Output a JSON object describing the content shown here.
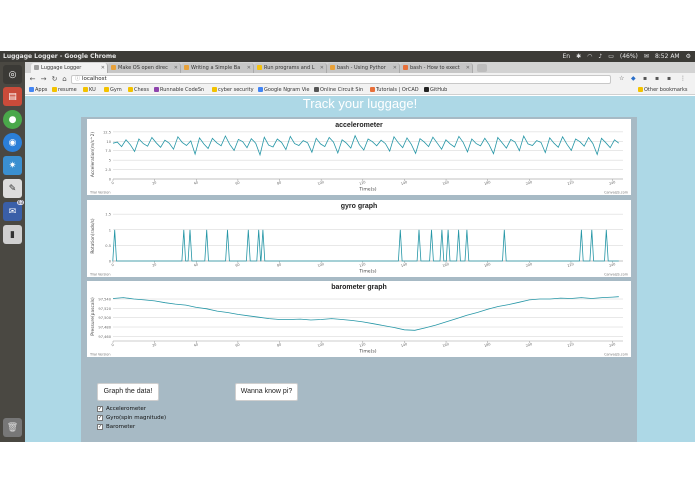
{
  "os": {
    "window_title": "Luggage Logger - Google Chrome",
    "battery": "(46%)",
    "time": "8:52 AM",
    "user": "Jon"
  },
  "launcher_badge": "63",
  "tabs": [
    {
      "label": "Luggage Logger",
      "color": "#9e9e9e"
    },
    {
      "label": "Make OS open direc",
      "color": "#e8a13a"
    },
    {
      "label": "Writing a Simple Ba",
      "color": "#e8a13a"
    },
    {
      "label": "Run programs and L",
      "color": "#f4c20d"
    },
    {
      "label": "bash - Using Pythor",
      "color": "#e8a13a"
    },
    {
      "label": "bash - How to exect",
      "color": "#e8703a"
    }
  ],
  "address": "localhost",
  "bookmarks": [
    {
      "label": "Apps",
      "color": "#4285f4"
    },
    {
      "label": "resume",
      "color": "#f2c200"
    },
    {
      "label": "KU",
      "color": "#f2c200"
    },
    {
      "label": "Gym",
      "color": "#f2c200"
    },
    {
      "label": "Chess",
      "color": "#f2c200"
    },
    {
      "label": "Runnable CodeSn",
      "color": "#8e44ad"
    },
    {
      "label": "cyber security",
      "color": "#f2c200"
    },
    {
      "label": "Google Ngram Vie",
      "color": "#4285f4"
    },
    {
      "label": "Online Circuit Sin",
      "color": "#555555"
    },
    {
      "label": "Tutorials | OrCAD",
      "color": "#e8703a"
    },
    {
      "label": "GitHub",
      "color": "#222222"
    },
    {
      "label": "Other bookmarks",
      "color": "#f2c200"
    }
  ],
  "page": {
    "title": "Track your luggage!",
    "graph_button": "Graph the data!",
    "pi_button": "Wanna know pi?",
    "checkboxes": [
      {
        "label": "Accelerometer",
        "checked": true
      },
      {
        "label": "Gyro(spin magnitude)",
        "checked": true
      },
      {
        "label": "Barometer",
        "checked": true
      }
    ]
  },
  "chart_data": [
    {
      "type": "line",
      "title": "accelerometer",
      "ylabel": "Acceleration(m/s^2)",
      "xlabel": "Time(s)",
      "credit": "CanvasJS.com",
      "trial": "Trial Version",
      "xlim": [
        0,
        245
      ],
      "ylim": [
        0,
        13
      ],
      "y_ticks": [
        0,
        2.5,
        5,
        7.5,
        10,
        12.5
      ],
      "y_tick_labels": [
        "0",
        "2.5",
        "5",
        "7.5",
        "10",
        "12.5"
      ],
      "x_ticks": [
        0,
        20,
        40,
        60,
        80,
        100,
        120,
        140,
        160,
        180,
        200,
        220,
        240
      ],
      "line_color": "#2596a6",
      "values": [
        9.5,
        9.8,
        8.6,
        10.4,
        9.1,
        7.3,
        10.6,
        9.4,
        8.7,
        11.0,
        9.6,
        8.4,
        10.3,
        9.5,
        7.9,
        11.2,
        9.7,
        8.9,
        10.1,
        6.6,
        10.9,
        9.3,
        8.1,
        10.8,
        9.6,
        8.8,
        11.4,
        9.2,
        7.6,
        10.5,
        9.9,
        8.3,
        10.7,
        9.5,
        6.4,
        11.1,
        9.0,
        8.5,
        10.6,
        9.7,
        7.8,
        11.3,
        9.4,
        8.9,
        10.2,
        9.6,
        7.1,
        10.8,
        9.3,
        8.6,
        11.0,
        9.8,
        6.9,
        10.4,
        9.5,
        8.2,
        11.5,
        9.1,
        7.7,
        10.6,
        9.9,
        8.8,
        10.3,
        9.4,
        7.4,
        11.2,
        9.6,
        8.3,
        10.9,
        9.2,
        6.8,
        10.7,
        9.8,
        8.6,
        11.1,
        9.5,
        7.9,
        10.4,
        9.3,
        8.5,
        11.3,
        9.7,
        7.2,
        10.6,
        9.4,
        8.8,
        10.8,
        9.1,
        6.7,
        11.0,
        9.6,
        8.2,
        10.5,
        9.8,
        7.5,
        11.4,
        9.3,
        8.9,
        10.2,
        9.7,
        7.0,
        10.9,
        9.5,
        8.4,
        11.2,
        9.2,
        7.6,
        10.6,
        9.9,
        8.7,
        11.0,
        9.4,
        6.5,
        10.8,
        9.6,
        8.3,
        10.4,
        9.5
      ]
    },
    {
      "type": "line",
      "title": "gyro graph",
      "ylabel": "Rotation(rads/s)",
      "xlabel": "Time(s)",
      "credit": "CanvasJS.com",
      "trial": "Trial Version",
      "xlim": [
        0,
        245
      ],
      "ylim": [
        0,
        1.6
      ],
      "y_ticks": [
        0,
        0.5,
        1,
        1.5
      ],
      "y_tick_labels": [
        "0",
        "0.5",
        "1",
        "1.5"
      ],
      "x_ticks": [
        0,
        20,
        40,
        60,
        80,
        100,
        120,
        140,
        160,
        180,
        200,
        220,
        240
      ],
      "line_color": "#2596a6",
      "spikes": [
        0.8,
        34,
        37,
        45,
        55,
        65,
        70,
        72,
        138,
        147,
        153,
        158,
        161,
        166,
        170,
        188,
        225,
        230,
        237
      ],
      "spike_value": 1
    },
    {
      "type": "line",
      "title": "barometer graph",
      "ylabel": "Pressure(pascals)",
      "xlabel": "Time(s)",
      "credit": "CanvasJS.com",
      "trial": "Trial Version",
      "xlim": [
        0,
        245
      ],
      "ylim": [
        97450,
        97555
      ],
      "y_ticks": [
        97460,
        97480,
        97500,
        97520,
        97540
      ],
      "y_tick_labels": [
        "97,460",
        "97,480",
        "97,500",
        "97,520",
        "97,540"
      ],
      "x_ticks": [
        0,
        20,
        40,
        60,
        80,
        100,
        120,
        140,
        160,
        180,
        200,
        220,
        240
      ],
      "line_color": "#2596a6",
      "x": [
        0,
        5,
        10,
        15,
        20,
        25,
        30,
        35,
        40,
        45,
        50,
        55,
        60,
        65,
        70,
        75,
        80,
        85,
        90,
        95,
        100,
        105,
        110,
        115,
        120,
        125,
        130,
        135,
        140,
        145,
        150,
        155,
        160,
        165,
        170,
        175,
        180,
        185,
        190,
        195,
        200,
        205,
        210,
        215,
        220,
        225,
        230,
        235,
        240,
        243
      ],
      "values": [
        97541,
        97543,
        97540,
        97538,
        97536,
        97532,
        97529,
        97527,
        97522,
        97519,
        97514,
        97511,
        97507,
        97504,
        97501,
        97498,
        97496,
        97496,
        97497,
        97495,
        97496,
        97498,
        97496,
        97494,
        97491,
        97487,
        97483,
        97479,
        97474,
        97473,
        97478,
        97484,
        97491,
        97498,
        97505,
        97511,
        97518,
        97524,
        97528,
        97533,
        97538,
        97540,
        97540,
        97542,
        97541,
        97543,
        97541,
        97543,
        97544,
        97545
      ]
    }
  ]
}
